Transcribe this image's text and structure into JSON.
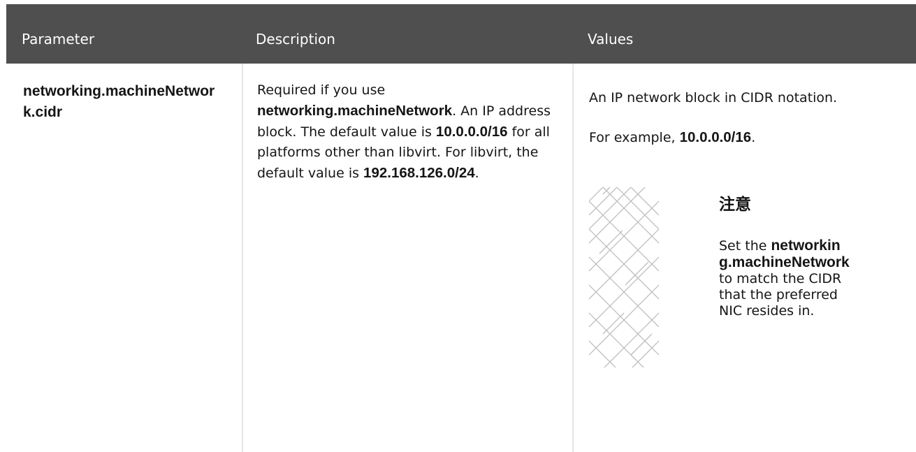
{
  "table": {
    "headers": {
      "parameter": "Parameter",
      "description": "Description",
      "values": "Values"
    },
    "row": {
      "parameter": "networking.machineNetwork.cidr",
      "description": {
        "t1": "Required if you use ",
        "b1": "networking.machineNetwork",
        "t2": ". An IP address block. The default value is ",
        "b2": "10.0.0.0/16",
        "t3": " for all platforms other than libvirt. For libvirt, the default value is ",
        "b3": "192.168.126.0/24",
        "t4": "."
      },
      "values": {
        "line1": "An IP network block in CIDR notation.",
        "example_prefix": "For example, ",
        "example_value": "10.0.0.0/16",
        "example_suffix": ".",
        "note": {
          "icon": "important-pattern-icon",
          "title": "注意",
          "t1": "Set the ",
          "b1": "networking.machineNetwork",
          "t2": " to match the CIDR that the preferred NIC resides in."
        }
      }
    }
  },
  "colors": {
    "header_bg": "#4f4f4f",
    "header_text": "#ffffff",
    "divider": "#e6e6e6",
    "body_text": "#151515"
  }
}
